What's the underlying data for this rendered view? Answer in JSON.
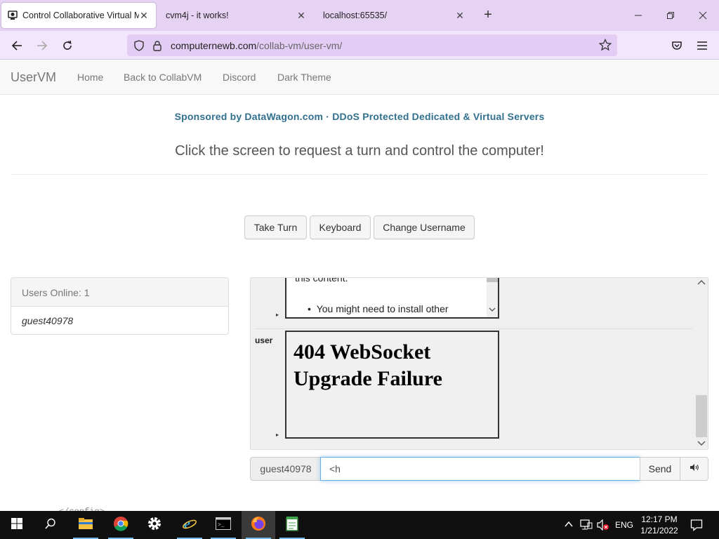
{
  "browser": {
    "tabs": [
      {
        "title": "Control Collaborative Virtual M",
        "icon": "collabvm-icon",
        "active": true
      },
      {
        "title": "cvm4j - it works!",
        "active": false
      },
      {
        "title": "localhost:65535/",
        "active": false
      }
    ],
    "url_domain": "computernewb.com",
    "url_path": "/collab-vm/user-vm/"
  },
  "site": {
    "brand": "UserVM",
    "nav": [
      "Home",
      "Back to CollabVM",
      "Discord",
      "Dark Theme"
    ],
    "sponsor": "Sponsored by DataWagon.com · DDoS Protected Dedicated & Virtual Servers",
    "request_text": "Click the screen to request a turn and control the computer!",
    "buttons": {
      "take_turn": "Take Turn",
      "keyboard": "Keyboard",
      "change_username": "Change Username"
    },
    "users": {
      "heading": "Users Online: 1",
      "list": [
        "guest40978"
      ]
    },
    "chat": {
      "msg1_cut_text": "this content.",
      "msg1_bullet": "You might need to install other",
      "msg2_user": "user",
      "msg2_heading": "404 WebSocket Upgrade Failure"
    },
    "chat_input": {
      "username": "guest40978",
      "value": "<h",
      "send_label": "Send"
    },
    "stray_text": "</config>"
  },
  "taskbar": {
    "language": "ENG",
    "time": "12:17 PM",
    "date": "1/21/2022"
  },
  "colors": {
    "tab_bar": "#e6d3f4",
    "url_bar": "#e3cdf5",
    "sponsor": "#31708f",
    "taskbar": "#101010"
  }
}
